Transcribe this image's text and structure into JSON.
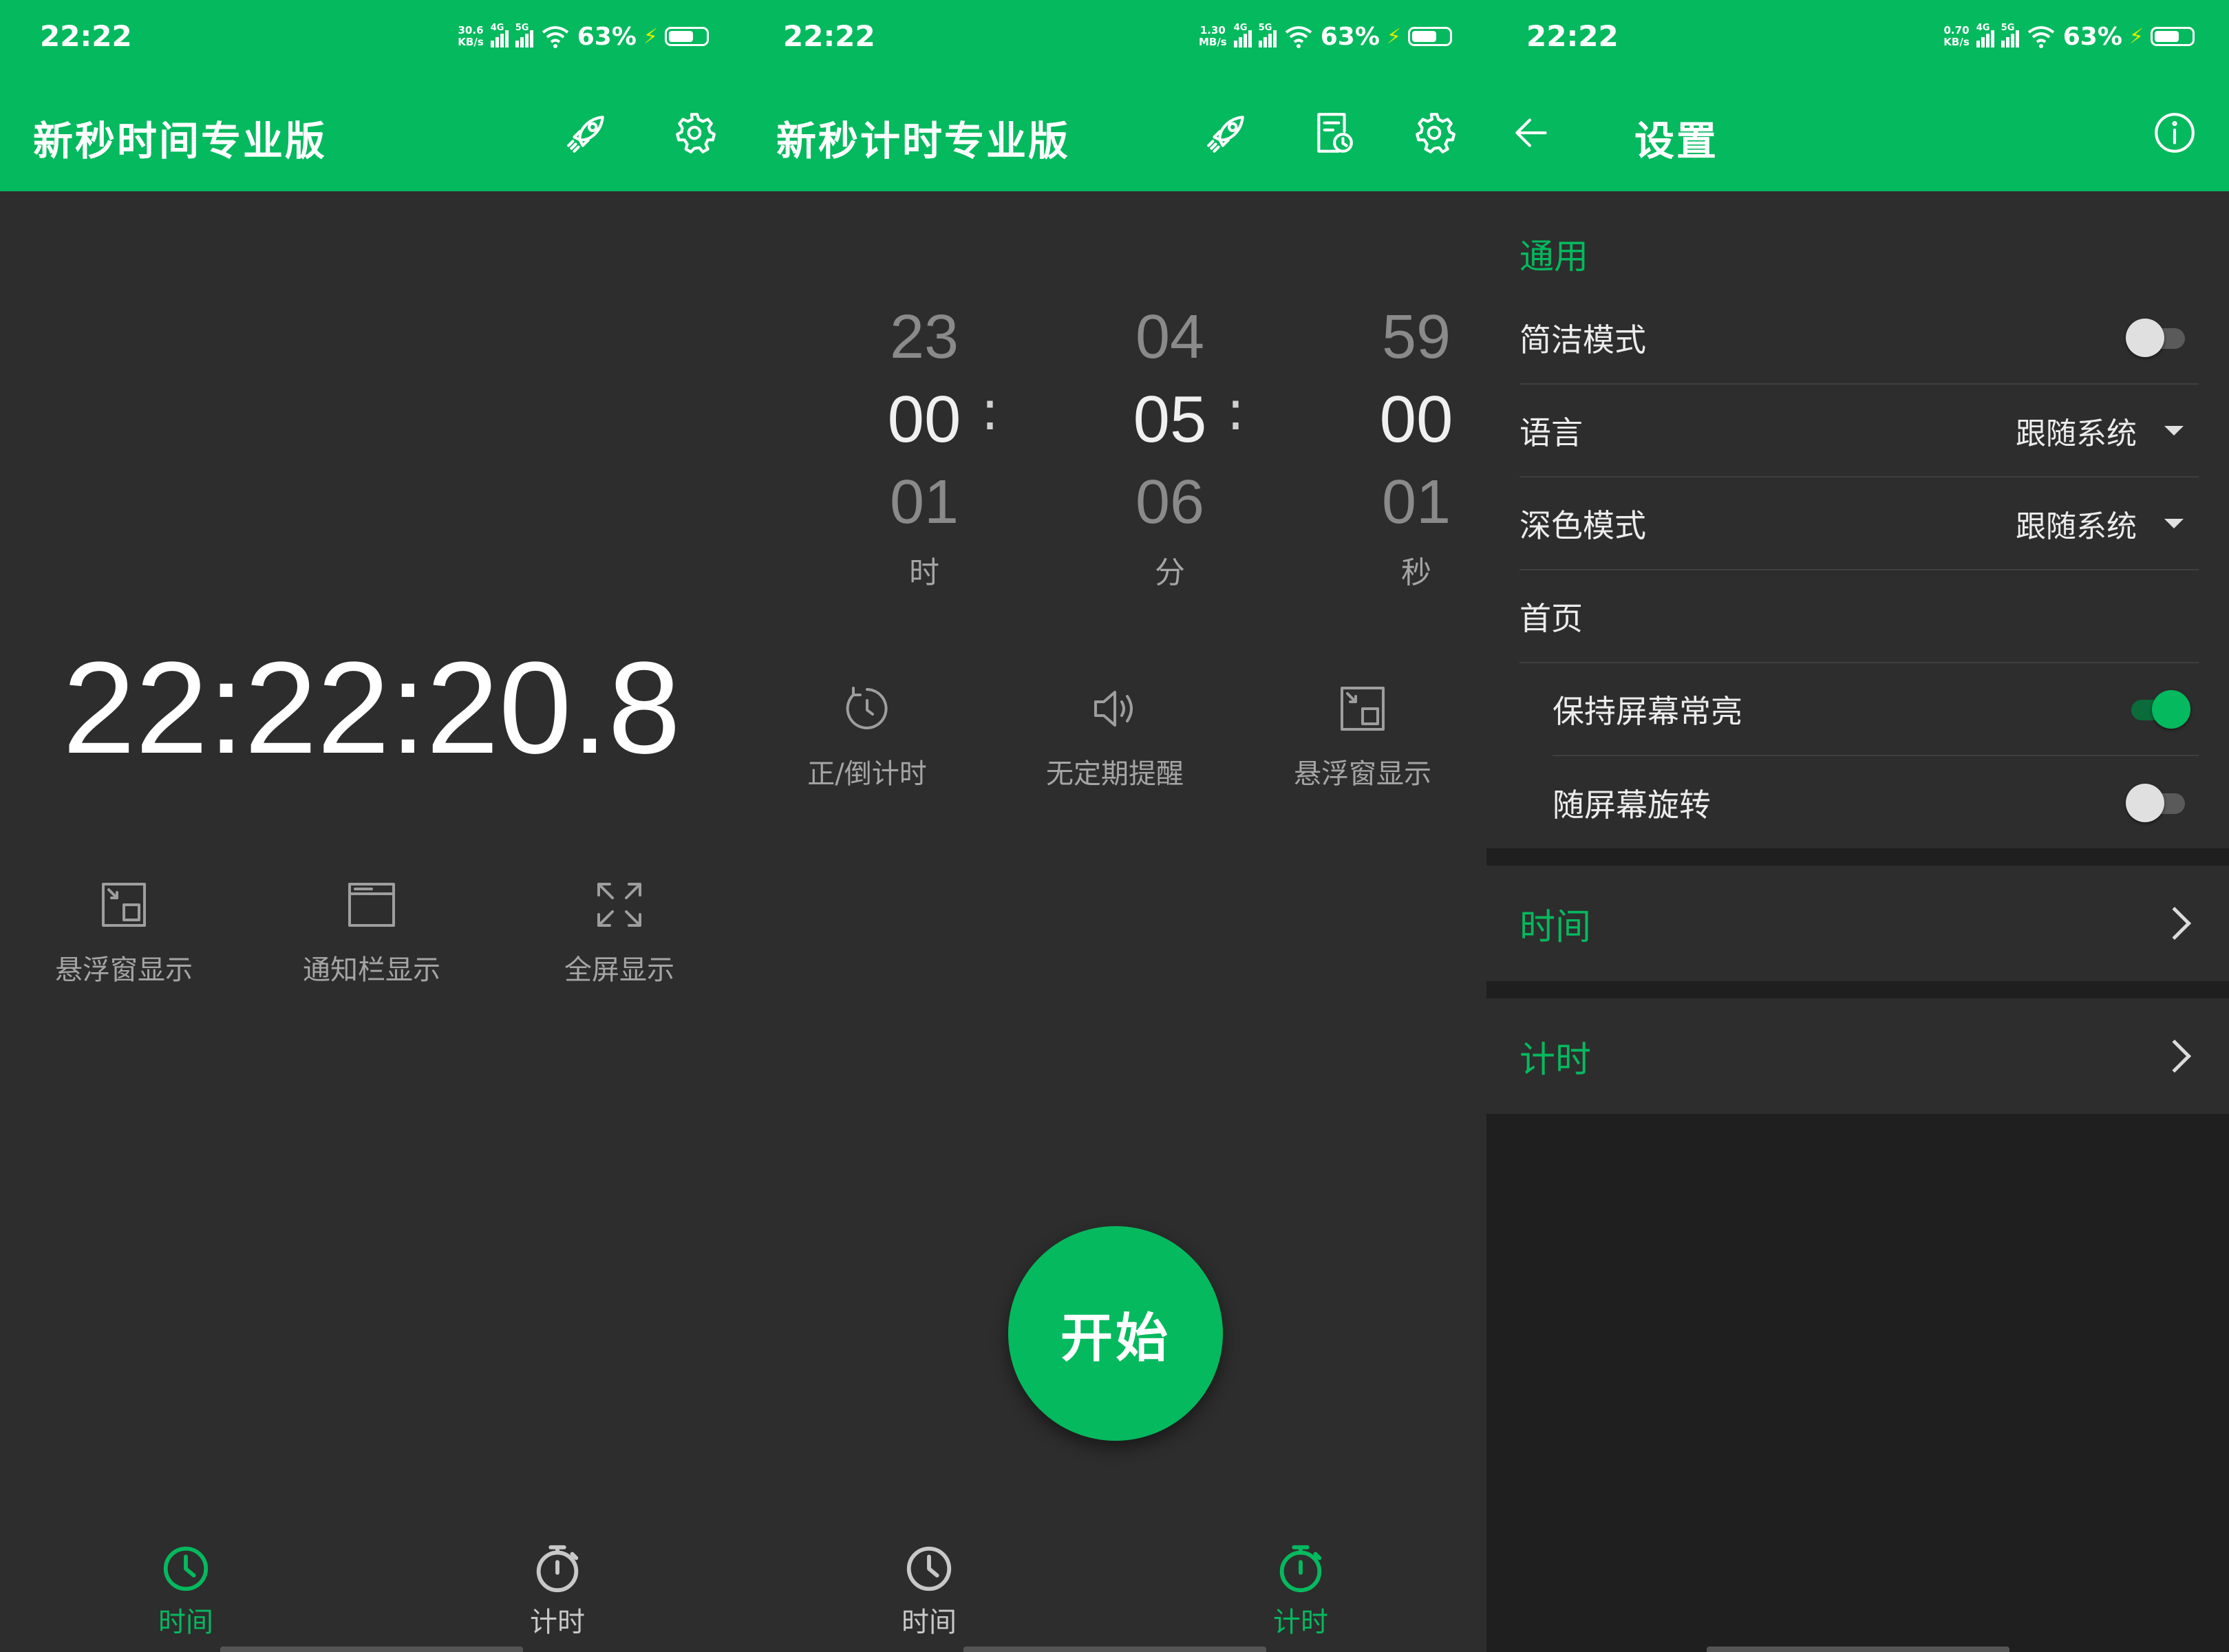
{
  "status": {
    "time": "22:22",
    "battery_pct": "63%",
    "net_4g": "4G",
    "net_5g": "5G",
    "panel1_speed": [
      "30.6",
      "KB/s"
    ],
    "panel2_speed": [
      "1.30",
      "MB/s"
    ],
    "panel3_speed": [
      "0.70",
      "KB/s"
    ]
  },
  "time_screen": {
    "title": "新秒时间专业版",
    "clock": "22:22:20.8",
    "actions": [
      "悬浮窗显示",
      "通知栏显示",
      "全屏显示"
    ]
  },
  "timer_screen": {
    "title": "新秒计时专业版",
    "picker": {
      "hours": {
        "prev": "23",
        "current": "00",
        "next": "01",
        "unit": "时"
      },
      "minutes": {
        "prev": "04",
        "current": "05",
        "next": "06",
        "unit": "分"
      },
      "seconds": {
        "prev": "59",
        "current": "00",
        "next": "01",
        "unit": "秒"
      },
      "separator": ":"
    },
    "actions": [
      "正/倒计时",
      "无定期提醒",
      "悬浮窗显示"
    ],
    "start_label": "开始"
  },
  "bottom_nav": [
    "时间",
    "计时"
  ],
  "settings_screen": {
    "title": "设置",
    "section_general": "通用",
    "rows": {
      "concise_mode": {
        "label": "简洁模式",
        "enabled": false
      },
      "language": {
        "label": "语言",
        "value": "跟随系统"
      },
      "dark_mode": {
        "label": "深色模式",
        "value": "跟随系统"
      },
      "home": {
        "label": "首页"
      },
      "keep_screen_on": {
        "label": "保持屏幕常亮",
        "enabled": true
      },
      "rotate_with_screen": {
        "label": "随屏幕旋转",
        "enabled": false
      }
    },
    "nav_time": "时间",
    "nav_timer": "计时"
  },
  "colors": {
    "accent": "#05b95e",
    "background": "#2d2d2d",
    "background_dark": "#1f1f1f"
  }
}
